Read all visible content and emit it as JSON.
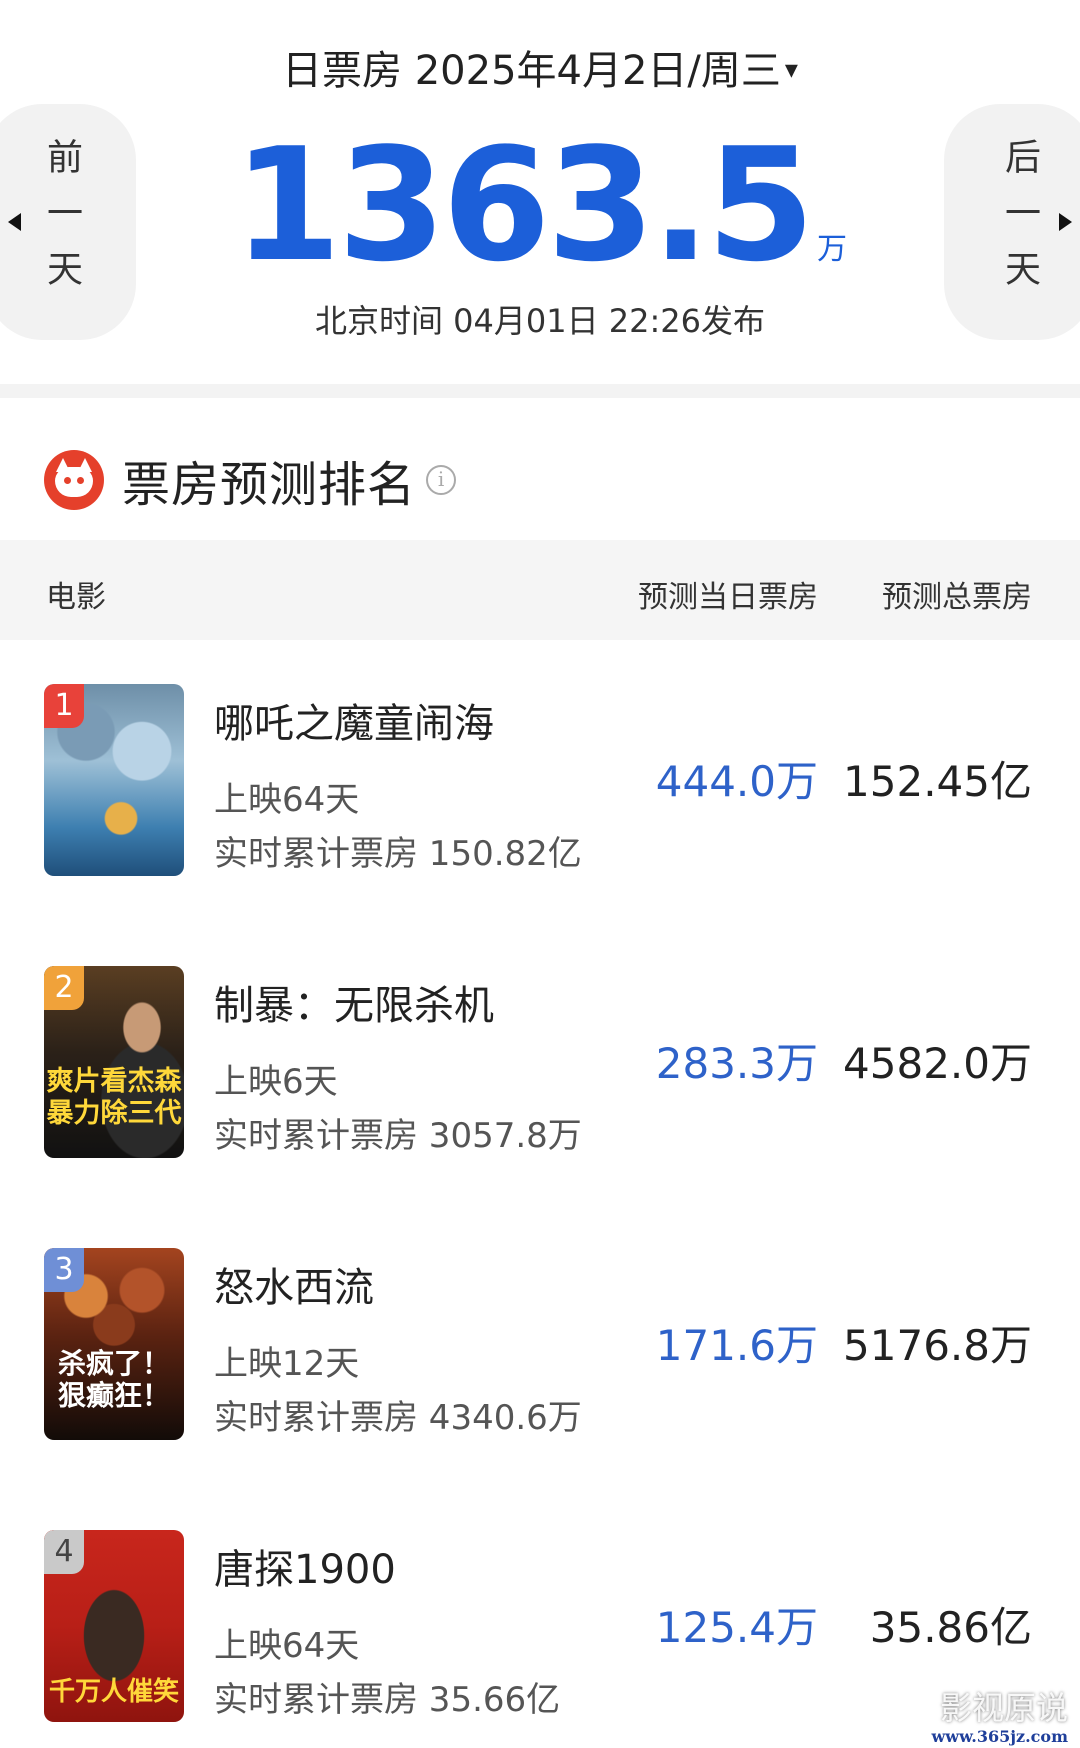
{
  "header": {
    "date_label": "日票房 2025年4月2日/周三",
    "prev_label": "前一天",
    "next_label": "后一天",
    "total_value": "1363.5",
    "total_unit": "万",
    "publish_info": "北京时间  04月01日  22:26发布"
  },
  "section": {
    "title": "票房预测排名",
    "info": "i"
  },
  "table_header": {
    "movie": "电影",
    "day_forecast": "预测当日票房",
    "total_forecast": "预测总票房"
  },
  "movies": [
    {
      "rank": "1",
      "badge_color": "#e8423a",
      "title": "哪吒之魔童闹海",
      "days": "上映64天",
      "cumulative": "实时累计票房 150.82亿",
      "day_gross": "444.0万",
      "total_gross": "152.45亿",
      "poster_text": ""
    },
    {
      "rank": "2",
      "badge_color": "#f0a23a",
      "title": "制暴：无限杀机",
      "days": "上映6天",
      "cumulative": "实时累计票房 3057.8万",
      "day_gross": "283.3万",
      "total_gross": "4582.0万",
      "poster_text": "爽片看杰森 暴力除三代"
    },
    {
      "rank": "3",
      "badge_color": "#6f8fd6",
      "title": "怒水西流",
      "days": "上映12天",
      "cumulative": "实时累计票房 4340.6万",
      "day_gross": "171.6万",
      "total_gross": "5176.8万",
      "poster_text": "杀疯了！ 狠癫狂！"
    },
    {
      "rank": "4",
      "badge_color": "#c9c9c9",
      "title": "唐探1900",
      "days": "上映64天",
      "cumulative": "实时累计票房 35.66亿",
      "day_gross": "125.4万",
      "total_gross": "35.86亿",
      "poster_text": "千万人催笑"
    }
  ],
  "watermark": {
    "line1": "影视原说",
    "line2": "www.365jz.com"
  }
}
